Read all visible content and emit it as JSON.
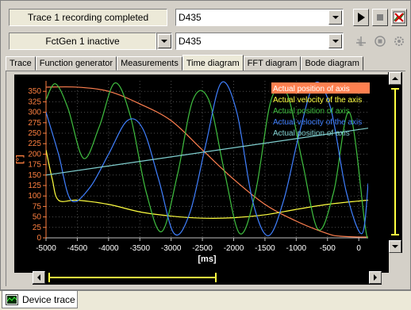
{
  "toolbar": {
    "status_recording": "Trace 1 recording completed",
    "device_top": "D435",
    "status_fctgen": "FctGen 1 inactive",
    "device_bottom": "D435"
  },
  "tabs": [
    {
      "label": "Trace",
      "active": false
    },
    {
      "label": "Function generator",
      "active": false
    },
    {
      "label": "Measurements",
      "active": false
    },
    {
      "label": "Time diagram",
      "active": true
    },
    {
      "label": "FFT diagram",
      "active": false
    },
    {
      "label": "Bode diagram",
      "active": false
    }
  ],
  "bottom": {
    "doc_tab": "Device trace"
  },
  "colors": {
    "plot_bg": "#000000",
    "axis_label": "#ff8040",
    "grid": "#505050"
  },
  "chart_data": {
    "type": "line",
    "xlabel": "[ms]",
    "ylabel": "[°]",
    "xlim": [
      -5000,
      150
    ],
    "ylim": [
      0,
      375
    ],
    "xticks": [
      -5000,
      -4500,
      -4000,
      -3500,
      -3000,
      -2500,
      -2000,
      -1500,
      -1000,
      -500,
      0
    ],
    "yticks": [
      0,
      25,
      50,
      75,
      100,
      125,
      150,
      175,
      200,
      225,
      250,
      275,
      300,
      325,
      350
    ],
    "grid": true,
    "legend_position": "top-right",
    "legend_highlight_index": 0,
    "series": [
      {
        "name": "Actual position of axis",
        "color": "#ff8050",
        "x": [
          -5000,
          -4500,
          -4000,
          -3500,
          -3000,
          -2500,
          -2000,
          -1500,
          -1000,
          -500,
          -300,
          0,
          150
        ],
        "y": [
          360,
          360,
          350,
          320,
          280,
          210,
          140,
          80,
          40,
          10,
          4,
          2,
          2
        ]
      },
      {
        "name": "Actual velocity of the axis",
        "color": "#ffff40",
        "x": [
          -5000,
          -4900,
          -4800,
          -4500,
          -4000,
          -3500,
          -3000,
          -2500,
          -2000,
          -1500,
          -1000,
          -500,
          0,
          150
        ],
        "y": [
          210,
          140,
          90,
          90,
          80,
          62,
          52,
          47,
          48,
          55,
          68,
          80,
          88,
          90
        ]
      },
      {
        "name": "Actual position of axis",
        "color": "#40c040",
        "x": [
          -5000,
          -4850,
          -4650,
          -4400,
          -4150,
          -3900,
          -3650,
          -3400,
          -3150,
          -2900,
          -2650,
          -2400,
          -2150,
          -1900,
          -1650,
          -1400,
          -1150,
          -900,
          -650,
          -400,
          -150,
          100,
          150
        ],
        "y": [
          330,
          368,
          310,
          190,
          265,
          370,
          290,
          110,
          15,
          150,
          330,
          330,
          160,
          10,
          110,
          330,
          345,
          180,
          20,
          110,
          300,
          30,
          0
        ]
      },
      {
        "name": "Actual velocity of the axis",
        "color": "#4080ff",
        "x": [
          -5000,
          -4800,
          -4600,
          -4300,
          -4000,
          -3700,
          -3450,
          -3200,
          -2950,
          -2700,
          -2450,
          -2200,
          -1950,
          -1700,
          -1450,
          -1200,
          -950,
          -700,
          -450,
          -200,
          50,
          150
        ],
        "y": [
          300,
          200,
          90,
          120,
          200,
          280,
          260,
          140,
          10,
          60,
          220,
          370,
          300,
          90,
          5,
          90,
          250,
          370,
          310,
          110,
          10,
          130
        ]
      },
      {
        "name": "Actual position of axis",
        "color": "#80d0d0",
        "x": [
          -5000,
          150
        ],
        "y": [
          150,
          262
        ]
      }
    ]
  }
}
